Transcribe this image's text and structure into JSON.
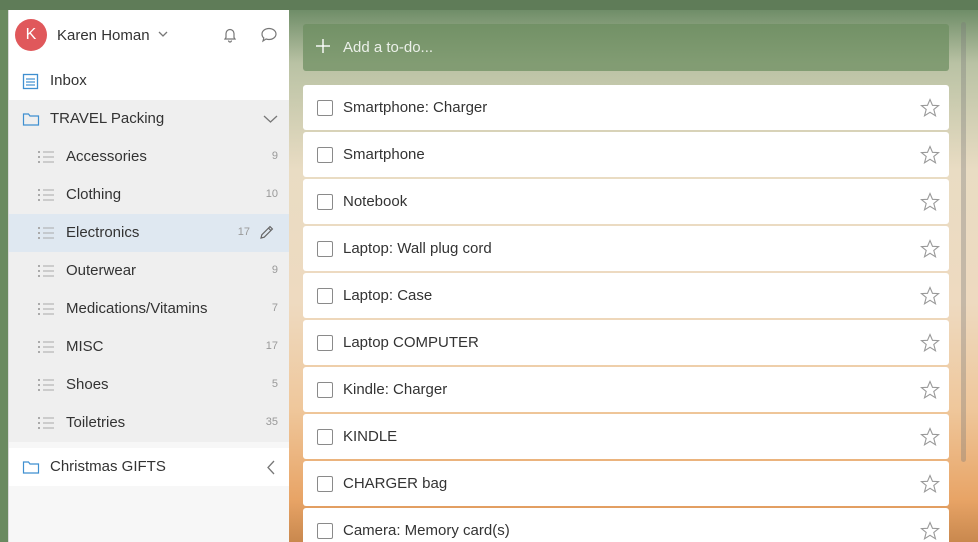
{
  "user": {
    "initial": "K",
    "name": "Karen Homan"
  },
  "sidebar": {
    "inbox": {
      "label": "Inbox"
    },
    "folder": {
      "label": "TRAVEL Packing"
    },
    "lists": [
      {
        "label": "Accessories",
        "count": "9"
      },
      {
        "label": "Clothing",
        "count": "10"
      },
      {
        "label": "Electronics",
        "count": "17"
      },
      {
        "label": "Outerwear",
        "count": "9"
      },
      {
        "label": "Medications/Vitamins",
        "count": "7"
      },
      {
        "label": "MISC",
        "count": "17"
      },
      {
        "label": "Shoes",
        "count": "5"
      },
      {
        "label": "Toiletries",
        "count": "35"
      }
    ],
    "folder2": {
      "label": "Christmas GIFTS"
    }
  },
  "main": {
    "add_placeholder": "Add a to-do...",
    "tasks": [
      {
        "title": "Smartphone: Charger"
      },
      {
        "title": "Smartphone"
      },
      {
        "title": "Notebook"
      },
      {
        "title": "Laptop: Wall plug cord"
      },
      {
        "title": "Laptop: Case"
      },
      {
        "title": "Laptop COMPUTER"
      },
      {
        "title": "Kindle: Charger"
      },
      {
        "title": "KINDLE"
      },
      {
        "title": "CHARGER bag"
      },
      {
        "title": "Camera: Memory card(s)"
      }
    ]
  },
  "colors": {
    "accent": "#e0585b",
    "active_list": "#dfe8f1",
    "folder_icon": "#3f8fd0"
  },
  "icons": [
    "chevron-down-icon",
    "bell-icon",
    "chat-icon",
    "inbox-icon",
    "folder-icon",
    "list-icon",
    "pencil-icon",
    "chevron-left-icon",
    "plus-icon",
    "star-icon"
  ]
}
